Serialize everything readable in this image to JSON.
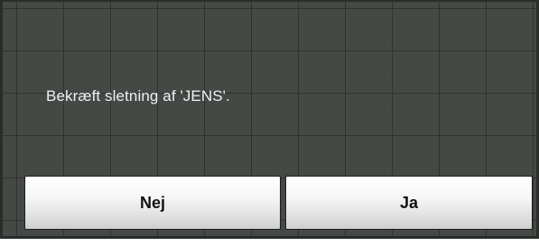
{
  "dialog": {
    "message": "Bekræft sletning af 'JENS'.",
    "buttons": {
      "no_label": "Nej",
      "yes_label": "Ja"
    }
  },
  "colors": {
    "background": "#454945",
    "grid_lines": "#1e201e",
    "message_text": "#f0f0f0",
    "button_face": "#f0f0f0",
    "button_text": "#111111"
  }
}
